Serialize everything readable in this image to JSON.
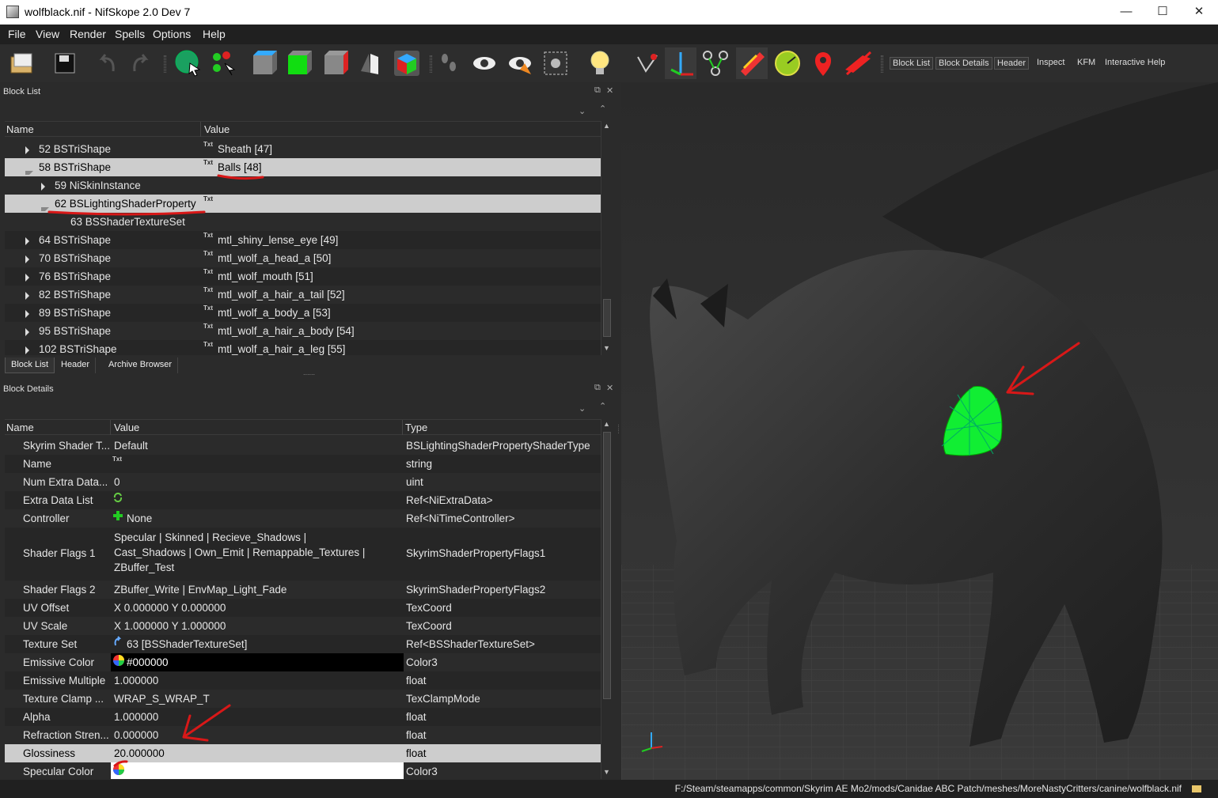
{
  "window": {
    "title": "wolfblack.nif - NifSkope 2.0 Dev 7",
    "minimize": "—",
    "maximize": "☐",
    "close": "✕"
  },
  "menu": [
    "File",
    "View",
    "Render",
    "Spells",
    "Options",
    "Help"
  ],
  "toolbar": {
    "icons": [
      "open-icon",
      "save-icon",
      "undo-icon",
      "redo-icon",
      "select-object-icon",
      "select-vertex-icon",
      "view-front-icon",
      "view-top-icon",
      "view-side-icon",
      "view-walk-icon",
      "view-perspective-icon",
      "hide-nodes-icon",
      "show-hidden-icon",
      "shape-icon",
      "screenshot-icon",
      "lighting-icon",
      "axis-icon",
      "move-icon",
      "bones-icon",
      "textures-icon",
      "vertex-colors-icon",
      "marker-icon",
      "hide-shapes-icon"
    ],
    "panel_buttons": [
      "Block List",
      "Block Details",
      "Header",
      "Inspect",
      "KFM",
      "Interactive Help"
    ]
  },
  "block_list": {
    "title": "Block List",
    "columns": [
      "Name",
      "Value"
    ],
    "rows": [
      {
        "expander": "right",
        "indent": 0,
        "name": "52 BSTriShape",
        "txt": "Txt",
        "value": "Sheath [47]"
      },
      {
        "expander": "down",
        "indent": 0,
        "name": "58 BSTriShape",
        "txt": "Txt",
        "value": "Balls [48]",
        "selected": true
      },
      {
        "expander": "right",
        "indent": 1,
        "name": "59 NiSkinInstance",
        "txt": "",
        "value": ""
      },
      {
        "expander": "down",
        "indent": 1,
        "name": "62 BSLightingShaderProperty",
        "txt": "Txt",
        "value": "",
        "selected": true
      },
      {
        "expander": "",
        "indent": 2,
        "name": "63 BSShaderTextureSet",
        "txt": "",
        "value": ""
      },
      {
        "expander": "right",
        "indent": 0,
        "name": "64 BSTriShape",
        "txt": "Txt",
        "value": "mtl_shiny_lense_eye [49]"
      },
      {
        "expander": "right",
        "indent": 0,
        "name": "70 BSTriShape",
        "txt": "Txt",
        "value": "mtl_wolf_a_head_a [50]"
      },
      {
        "expander": "right",
        "indent": 0,
        "name": "76 BSTriShape",
        "txt": "Txt",
        "value": "mtl_wolf_mouth [51]"
      },
      {
        "expander": "right",
        "indent": 0,
        "name": "82 BSTriShape",
        "txt": "Txt",
        "value": "mtl_wolf_a_hair_a_tail [52]"
      },
      {
        "expander": "right",
        "indent": 0,
        "name": "89 BSTriShape",
        "txt": "Txt",
        "value": "mtl_wolf_a_body_a [53]"
      },
      {
        "expander": "right",
        "indent": 0,
        "name": "95 BSTriShape",
        "txt": "Txt",
        "value": "mtl_wolf_a_hair_a_body [54]"
      },
      {
        "expander": "right",
        "indent": 0,
        "name": "102 BSTriShape",
        "txt": "Txt",
        "value": "mtl_wolf_a_hair_a_leg [55]"
      }
    ],
    "tabs": [
      "Block List",
      "Header",
      "Archive Browser"
    ],
    "active_tab": "Block List"
  },
  "block_details": {
    "title": "Block Details",
    "columns": [
      "Name",
      "Value",
      "Type"
    ],
    "rows": [
      {
        "name": "Skyrim Shader T...",
        "icon": "",
        "value": "Default",
        "type": "BSLightingShaderPropertyShaderType"
      },
      {
        "name": "Name",
        "icon": "Txt",
        "value": "",
        "type": "string"
      },
      {
        "name": "Num Extra Data...",
        "icon": "",
        "value": "0",
        "type": "uint"
      },
      {
        "name": "Extra Data List",
        "icon": "refresh",
        "value": "",
        "type": "Ref<NiExtraData>"
      },
      {
        "name": "Controller",
        "icon": "plus",
        "value": "None",
        "type": "Ref<NiTimeController>"
      },
      {
        "name": "Shader Flags 1",
        "icon": "",
        "value": "Specular | Skinned | Recieve_Shadows | Cast_Shadows | Own_Emit | Remappable_Textures | ZBuffer_Test",
        "type": "SkyrimShaderPropertyFlags1",
        "tall": true
      },
      {
        "name": "Shader Flags 2",
        "icon": "",
        "value": "ZBuffer_Write | EnvMap_Light_Fade",
        "type": "SkyrimShaderPropertyFlags2"
      },
      {
        "name": "UV Offset",
        "icon": "",
        "value": "X 0.000000 Y 0.000000",
        "type": "TexCoord"
      },
      {
        "name": "UV Scale",
        "icon": "",
        "value": "X 1.000000 Y 1.000000",
        "type": "TexCoord"
      },
      {
        "name": "Texture Set",
        "icon": "link",
        "value": "63 [BSShaderTextureSet]",
        "type": "Ref<BSShaderTextureSet>"
      },
      {
        "name": "Emissive Color",
        "icon": "color",
        "value": "#000000",
        "type": "Color3",
        "swatch": "#000000"
      },
      {
        "name": "Emissive Multiple",
        "icon": "",
        "value": "1.000000",
        "type": "float"
      },
      {
        "name": "Texture Clamp ...",
        "icon": "",
        "value": "WRAP_S_WRAP_T",
        "type": "TexClampMode"
      },
      {
        "name": "Alpha",
        "icon": "",
        "value": "1.000000",
        "type": "float"
      },
      {
        "name": "Refraction Stren...",
        "icon": "",
        "value": "0.000000",
        "type": "float"
      },
      {
        "name": "Glossiness",
        "icon": "",
        "value": "20.000000",
        "type": "float",
        "selected": true
      },
      {
        "name": "Specular Color",
        "icon": "color",
        "value": "",
        "type": "Color3",
        "swatch": "#ffffff"
      }
    ]
  },
  "status": {
    "path": "F:/Steam/steamapps/common/Skyrim AE Mo2/mods/Canidae ABC Patch/meshes/MoreNastyCritters/canine/wolfblack.nif"
  },
  "colors": {
    "highlight": "#00ff44",
    "annotation": "#d81818",
    "selection": "#cdcdcd"
  }
}
